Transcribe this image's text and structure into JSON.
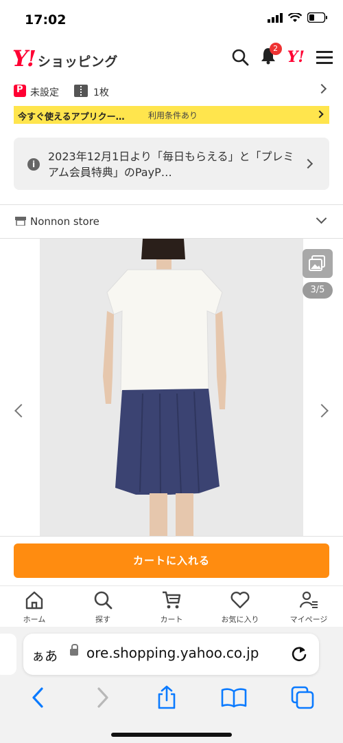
{
  "status_bar": {
    "time": "17:02"
  },
  "header": {
    "logo_mark": "Y!",
    "logo_text": "ショッピング",
    "notification_count": "2",
    "yahoo_mark": "Y!"
  },
  "paypay_row": {
    "point_label": "未設定",
    "coupon_label": "1枚"
  },
  "banner": {
    "text": "今すぐ使えるアプリクー…",
    "terms": "利用条件あり"
  },
  "notice": {
    "text": "2023年12月1日より「毎日もらえる」と「プレミアム会員特典」のPayP…"
  },
  "store": {
    "name": "Nonnon store"
  },
  "product_image": {
    "counter": "3/5"
  },
  "cart_button": {
    "label": "カートに入れる"
  },
  "bottom_tabs": [
    {
      "label": "ホーム",
      "icon": "home-icon"
    },
    {
      "label": "探す",
      "icon": "search-icon"
    },
    {
      "label": "カート",
      "icon": "cart-icon"
    },
    {
      "label": "お気に入り",
      "icon": "heart-icon"
    },
    {
      "label": "マイページ",
      "icon": "user-icon"
    }
  ],
  "browser": {
    "aa_label": "ぁあ",
    "url": "ore.shopping.yahoo.co.jp"
  },
  "colors": {
    "brand_red": "#ff0033",
    "cart_orange": "#ff8c10",
    "banner_yellow": "#ffe54d",
    "ios_blue": "#0a7aff"
  }
}
